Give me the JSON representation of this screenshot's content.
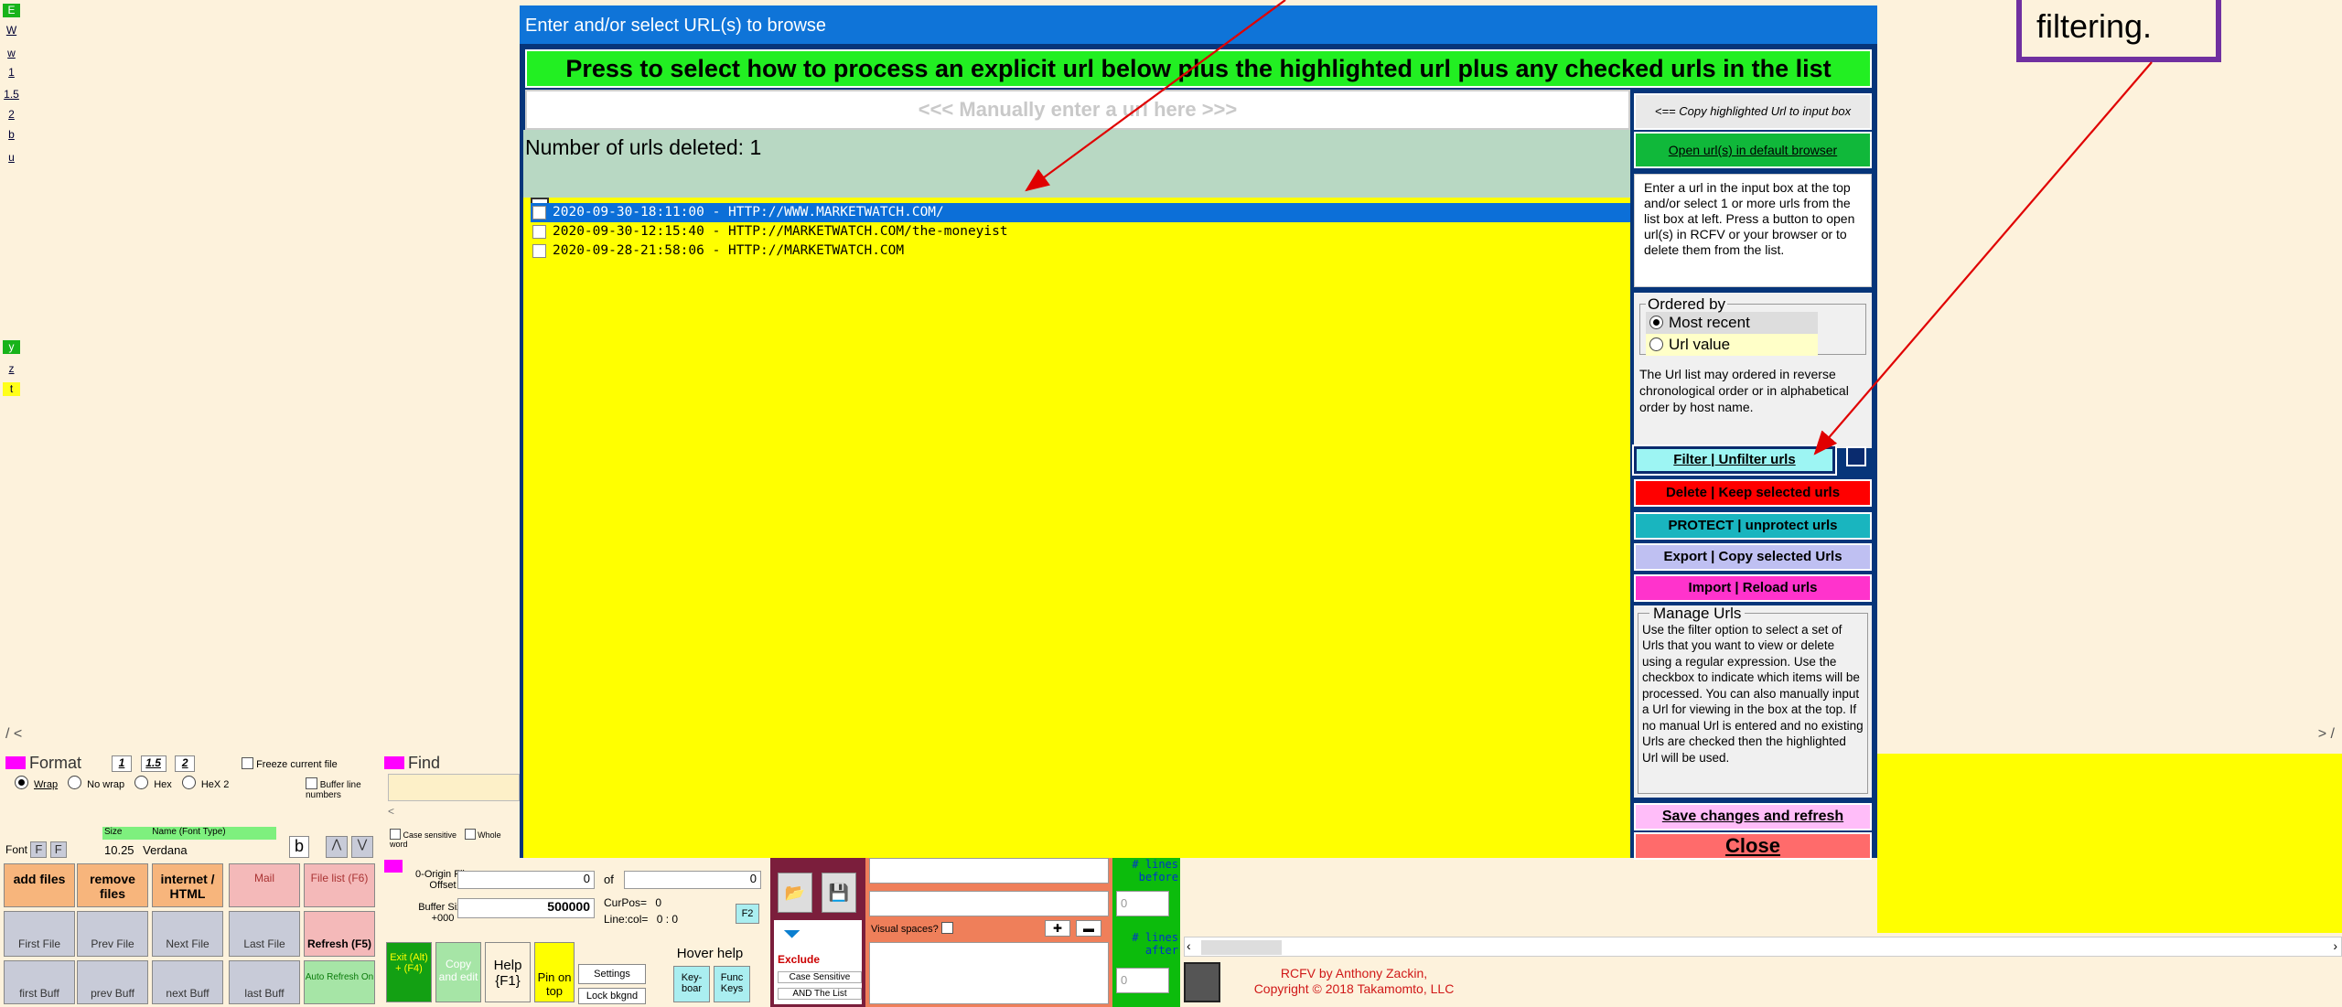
{
  "left_tags": [
    {
      "label": "E",
      "style": "green"
    },
    {
      "label": "W",
      "style": "plain"
    },
    {
      "label": "w",
      "style": "plain"
    },
    {
      "label": "1",
      "style": "plain"
    },
    {
      "label": "1.5",
      "style": "plain"
    },
    {
      "label": "2",
      "style": "plain"
    },
    {
      "label": "b",
      "style": "plain"
    },
    {
      "label": "u",
      "style": "plain"
    },
    {
      "label": "y",
      "style": "green"
    },
    {
      "label": "z",
      "style": "plain"
    },
    {
      "label": "t",
      "style": "yellow"
    }
  ],
  "callout": {
    "text": "filtering."
  },
  "dialog": {
    "title": "Enter and/or select URL(s) to browse",
    "press_button": "Press to select how to process an explicit url below plus the highlighted url plus any checked urls in the list",
    "url_input_placeholder": "<<< Manually enter a url here >>>",
    "deleted_text": "Number of urls deleted: 1",
    "urls": [
      {
        "text": "2020-09-30-18:11:00 - HTTP://WWW.MARKETWATCH.COM/",
        "selected": true
      },
      {
        "text": "2020-09-30-12:15:40 - HTTP://MARKETWATCH.COM/the-moneyist",
        "selected": false
      },
      {
        "text": "2020-09-28-21:58:06 - HTTP://MARKETWATCH.COM",
        "selected": false
      }
    ],
    "copy_button": "<== Copy highlighted Url to input box",
    "open_button": "Open url(s) in default browser",
    "help_text": "Enter a url in the input box at the top and/or select 1 or more urls from the list box at left. Press a button to open url(s) in RCFV or your browser or to delete them from the list.",
    "ordered_by": {
      "legend": "Ordered by",
      "options": [
        "Most recent",
        "Url value"
      ],
      "selected": "Most recent",
      "note": "The Url list may ordered in reverse chronological order or in alphabetical order by host name."
    },
    "filter_button": "Filter | Unfilter urls",
    "delete_button": "Delete | Keep selected urls",
    "protect_button": "PROTECT | unprotect urls",
    "export_button": "Export | Copy selected Urls",
    "import_button": "Import | Reload urls",
    "manage": {
      "legend": "Manage Urls",
      "text": "Use the filter option to select a set of Urls that you want to view or delete using a regular expression. Use the checkbox to indicate which items will be processed. You can also manually input a Url for viewing in the box at the top. If no manual Url is entered and no existing Urls are checked then the highlighted Url will be used."
    },
    "save_button": "Save changes and refresh",
    "close_button": "Close"
  },
  "bottom": {
    "scroll_left": "/ <",
    "scroll_right": "> /",
    "format_label": "Format",
    "format_sizes": [
      "1",
      "1.5",
      "2"
    ],
    "freeze_label": "Freeze current file",
    "wrap_options": [
      "Wrap",
      "No wrap",
      "Hex",
      "HeX 2"
    ],
    "buffer_line_numbers": "Buffer line numbers",
    "find_label": "Find",
    "case_sensitive": "Case sensitive",
    "whole_word": "Whole word",
    "font_label": "Font",
    "size_label": "Size",
    "font_name_label": "Name (Font Type)",
    "font_size": "10.25",
    "font_name": "Verdana",
    "buttons_row1": [
      "add files",
      "remove files",
      "internet / HTML",
      "Mail",
      "File list (F6)"
    ],
    "buttons_row2": [
      "First File",
      "Prev File",
      "Next File",
      "Last File",
      "Refresh (F5)"
    ],
    "buttons_row3": [
      "first Buff",
      "prev Buff",
      "next Buff",
      "last Buff",
      "Auto Refresh On"
    ],
    "origin_label": "0-Origin File Offset",
    "origin_value": "0",
    "of_label": "of",
    "of_value": "0",
    "buffer_size_label": "Buffer Size +000",
    "buffer_size_value": "500000",
    "curpos_label": "CurPos=",
    "curpos_value": "0",
    "linecol_label": "Line:col=",
    "linecol_value": "0 : 0",
    "f2_label": "F2",
    "exit_label": "Exit (Alt) + (F4)",
    "copy_edit_label": "Copy and edit",
    "help_label": "Help {F1}",
    "pin_label": "Pin on top",
    "settings_label": "Settings",
    "lock_label": "Lock bkgnd",
    "hover_help": "Hover help",
    "keyboard_label": "Key-boar",
    "func_keys": "Func Keys",
    "exclude_label": "Exclude",
    "exclude_case": "Case Sensitive",
    "exclude_and": "AND The List",
    "visual_spaces": "Visual spaces?",
    "lines_before": "# lines before",
    "lines_after": "# lines after",
    "lines_before_value": "0",
    "lines_after_value": "0",
    "credit_line1": "RCFV by Anthony Zackin,",
    "credit_line2": "Copyright © 2018 Takamomto, LLC"
  },
  "colors": {
    "dialog_frame": "#06357a",
    "title_bar": "#0f74d8",
    "press_button": "#22ef22",
    "list_bg": "#ffff00",
    "selection": "#0c6fd8",
    "callout_border": "#7030a0",
    "arrow": "#e00000"
  }
}
